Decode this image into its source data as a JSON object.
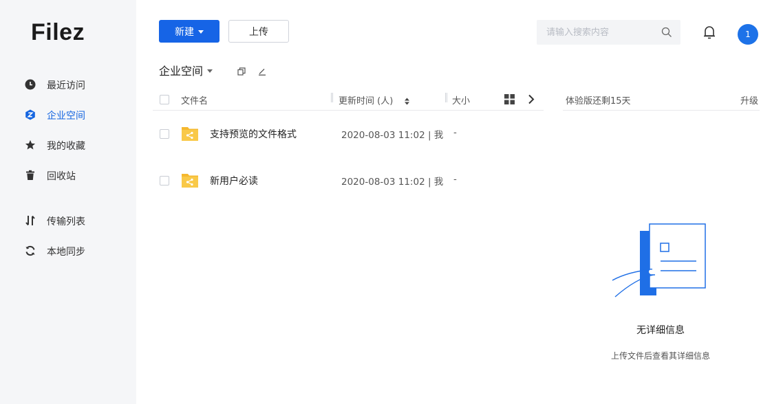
{
  "app": {
    "logo": "Filez"
  },
  "sidebar": {
    "items": [
      {
        "label": "最近访问",
        "icon": "clock-icon"
      },
      {
        "label": "企业空间",
        "icon": "enterprise-space-icon",
        "active": true
      },
      {
        "label": "我的收藏",
        "icon": "star-icon"
      },
      {
        "label": "回收站",
        "icon": "trash-icon"
      },
      {
        "label": "传输列表",
        "icon": "transfer-icon"
      },
      {
        "label": "本地同步",
        "icon": "sync-icon"
      }
    ]
  },
  "toolbar": {
    "new_label": "新建",
    "upload_label": "上传"
  },
  "search": {
    "placeholder": "请输入搜索内容"
  },
  "notifications": {
    "badge": "1"
  },
  "breadcrumb": {
    "title": "企业空间"
  },
  "table": {
    "columns": {
      "name": "文件名",
      "time": "更新时间 (人)",
      "size": "大小"
    },
    "rows": [
      {
        "name": "支持预览的文件格式",
        "time": "2020-08-03 11:02 | 我",
        "size": "-"
      },
      {
        "name": "新用户必读",
        "time": "2020-08-03 11:02 | 我",
        "size": "-"
      }
    ]
  },
  "detail": {
    "trial": "体验版还剩15天",
    "upgrade": "升级",
    "empty_title": "无详细信息",
    "empty_sub": "上传文件后查看其详细信息"
  },
  "colors": {
    "accent": "#1664e6",
    "folder": "#f5b82e",
    "sidebar_bg": "#f5f6f8"
  }
}
